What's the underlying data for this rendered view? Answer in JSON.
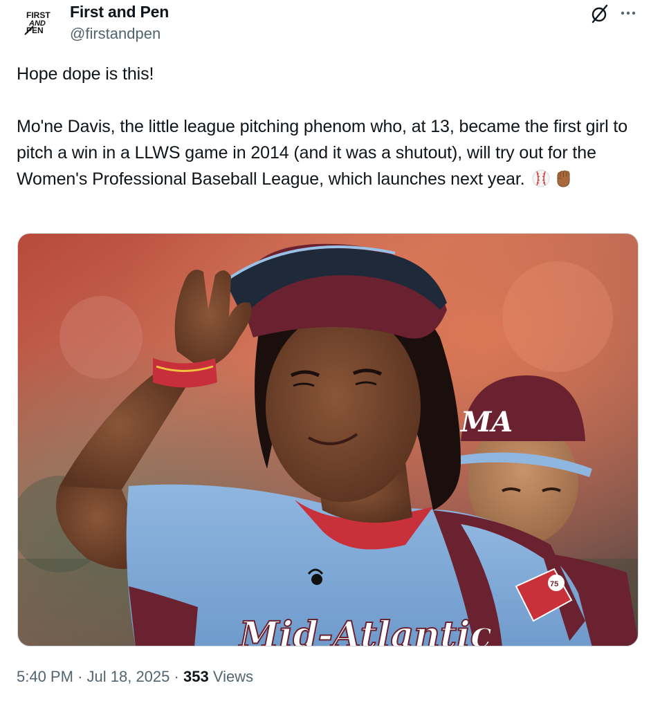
{
  "author": {
    "display_name": "First and Pen",
    "handle": "@firstandpen",
    "avatar_logo_text": [
      "FIRST",
      "AND",
      "PEN"
    ]
  },
  "post": {
    "paragraphs": [
      "Hope dope is this!",
      "Mo'ne Davis, the little league pitching phenom who, at 13, became the first girl to pitch a win in a LLWS game in 2014 (and it was a shutout), will try out for the Women's Professional Baseball League, which launches next year."
    ],
    "emojis": [
      "baseball-emoji",
      "raised-fist-emoji"
    ],
    "media": {
      "kind": "photo",
      "cap_text": "MA",
      "jersey_text": "Mid-Atlantic",
      "patch_text": "75"
    }
  },
  "footer": {
    "time": "5:40 PM",
    "separator": "·",
    "date": "Jul 18, 2025",
    "views_count": "353",
    "views_label": "Views"
  },
  "icons": {
    "grok": "grok-icon",
    "more": "more-icon"
  },
  "colors": {
    "text_primary": "#0f1419",
    "text_secondary": "#536471",
    "border": "#cfd9de"
  }
}
